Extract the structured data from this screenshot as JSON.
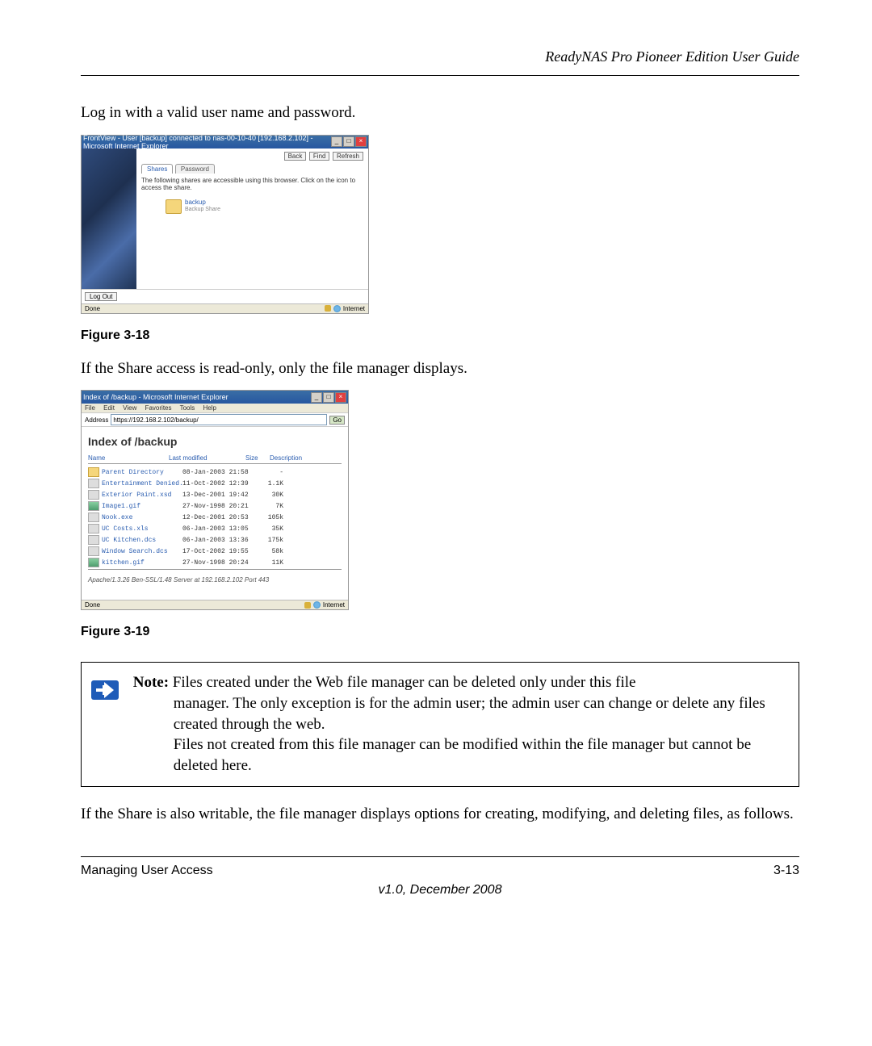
{
  "header": {
    "title": "ReadyNAS Pro Pioneer Edition User Guide"
  },
  "p1": "Log in with a valid user name and password.",
  "shot1": {
    "title": "FrontView - User [backup] connected to nas-00-10-40 [192.168.2.102] - Microsoft Internet Explorer",
    "btn_back": "Back",
    "btn_find": "Find",
    "btn_refresh": "Refresh",
    "tab_shares": "Shares",
    "tab_password": "Password",
    "desc": "The following shares are accessible using this browser. Click on the icon to access the share.",
    "share_name": "backup",
    "share_sub": "Backup Share",
    "logout": "Log Out",
    "status_left": "Done",
    "status_right": "Internet"
  },
  "fig1_caption": "Figure 3-18",
  "p2": "If the Share access is read-only, only the file manager displays.",
  "shot2": {
    "title": "Index of /backup - Microsoft Internet Explorer",
    "menu": {
      "file": "File",
      "edit": "Edit",
      "view": "View",
      "fav": "Favorites",
      "tools": "Tools",
      "help": "Help"
    },
    "addr_label": "Address",
    "addr": "https://192.168.2.102/backup/",
    "go": "Go",
    "index_title": "Index of /backup",
    "hdr": {
      "name": "Name",
      "mod": "Last modified",
      "size": "Size",
      "desc": "Description"
    },
    "rows": [
      {
        "ico": "folder",
        "name": "Parent Directory",
        "date": "08-Jan-2003 21:58",
        "size": "-"
      },
      {
        "ico": "file",
        "name": "Entertainment Denied.XSD",
        "date": "11-Oct-2002 12:39",
        "size": "1.1K"
      },
      {
        "ico": "file",
        "name": "Exterior Paint.xsd",
        "date": "13-Dec-2001 19:42",
        "size": "30K"
      },
      {
        "ico": "img",
        "name": "Image1.gif",
        "date": "27-Nov-1998 20:21",
        "size": "7K"
      },
      {
        "ico": "file",
        "name": "Nook.exe",
        "date": "12-Dec-2001 20:53",
        "size": "105k"
      },
      {
        "ico": "file",
        "name": "UC Costs.xls",
        "date": "06-Jan-2003 13:05",
        "size": "35K"
      },
      {
        "ico": "file",
        "name": "UC Kitchen.dcs",
        "date": "06-Jan-2003 13:36",
        "size": "175k"
      },
      {
        "ico": "file",
        "name": "Window Search.dcs",
        "date": "17-Oct-2002 19:55",
        "size": "58k"
      },
      {
        "ico": "img",
        "name": "kitchen.gif",
        "date": "27-Nov-1998 20:24",
        "size": "11K"
      }
    ],
    "server": "Apache/1.3.26 Ben-SSL/1.48 Server at 192.168.2.102 Port 443",
    "status_left": "Done",
    "status_right": "Internet"
  },
  "fig2_caption": "Figure 3-19",
  "note": {
    "label": "Note:",
    "line1a": " Files created under the Web file manager can be deleted only under this file",
    "line1b": "manager. The only exception is for the admin user; the admin user can change or delete any files created through the web.",
    "line2": "Files not created from this file manager can be modified within the file manager but cannot be deleted here."
  },
  "p3": "If the Share is also writable, the file manager displays options for creating, modifying, and deleting files, as follows.",
  "footer": {
    "left": "Managing User Access",
    "right": "3-13",
    "version": "v1.0, December 2008"
  }
}
